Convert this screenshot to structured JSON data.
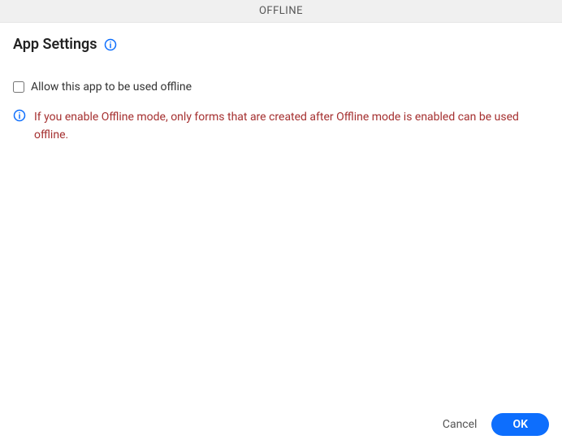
{
  "header": {
    "tab_label": "OFFLINE"
  },
  "title": "App Settings",
  "checkbox": {
    "label": "Allow this app to be used offline",
    "checked": false
  },
  "warning": {
    "text": "If you enable Offline mode, only forms that are created after Offline mode is enabled can be used offline."
  },
  "footer": {
    "cancel_label": "Cancel",
    "ok_label": "OK"
  },
  "colors": {
    "accent": "#0d6efd",
    "warning_text": "#a53030"
  }
}
